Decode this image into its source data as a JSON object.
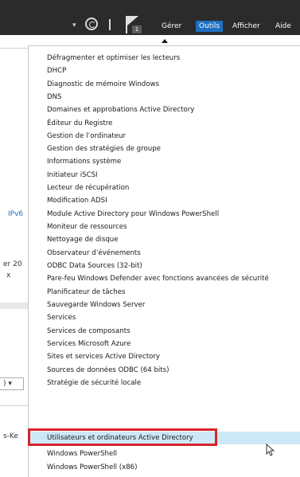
{
  "toolbar": {
    "notification_count": "1",
    "gerer": "Gérer",
    "outils": "Outils",
    "afficher": "Afficher",
    "aide": "Aide",
    "accent_color": "#1e70c1",
    "bar_color": "#2b2b2b"
  },
  "left_pane": {
    "ipv6": "IPv6",
    "er_fragment": "er 20",
    "x_fragment": "x",
    "combo_fragment": ") ▾",
    "ske_fragment": "s-Ke"
  },
  "menu": {
    "items": [
      "Défragmenter et optimiser les lecteurs",
      "DHCP",
      "Diagnostic de mémoire Windows",
      "DNS",
      "Domaines et approbations Active Directory",
      "Éditeur du Registre",
      "Gestion de l’ordinateur",
      "Gestion des stratégies de groupe",
      "Informations système",
      "Initiateur iSCSI",
      "Lecteur de récupération",
      "Modification ADSI",
      "Module Active Directory pour Windows PowerShell",
      "Moniteur de ressources",
      "Nettoyage de disque",
      "Observateur d’événements",
      "ODBC Data Sources (32-bit)",
      "Pare-feu Windows Defender avec fonctions avancées de sécurité",
      "Planificateur de tâches",
      "Sauvegarde Windows Server",
      "Services",
      "Services de composants",
      "Services Microsoft Azure",
      "Sites et services Active Directory",
      "Sources de données ODBC (64 bits)",
      "Stratégie de sécurité locale",
      "Utilisateurs et ordinateurs Active Directory",
      "Windows PowerShell",
      "Windows PowerShell (x86)"
    ],
    "highlighted_index": 26,
    "highlight_color": "#cde8f7",
    "annotation_color": "#d8232a"
  }
}
